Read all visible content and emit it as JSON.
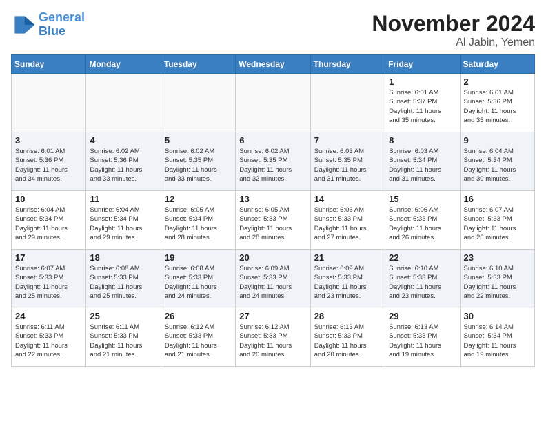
{
  "header": {
    "logo_line1": "General",
    "logo_line2": "Blue",
    "month": "November 2024",
    "location": "Al Jabin, Yemen"
  },
  "days_of_week": [
    "Sunday",
    "Monday",
    "Tuesday",
    "Wednesday",
    "Thursday",
    "Friday",
    "Saturday"
  ],
  "weeks": [
    [
      {
        "day": "",
        "info": "",
        "empty": true
      },
      {
        "day": "",
        "info": "",
        "empty": true
      },
      {
        "day": "",
        "info": "",
        "empty": true
      },
      {
        "day": "",
        "info": "",
        "empty": true
      },
      {
        "day": "",
        "info": "",
        "empty": true
      },
      {
        "day": "1",
        "info": "Sunrise: 6:01 AM\nSunset: 5:37 PM\nDaylight: 11 hours\nand 35 minutes."
      },
      {
        "day": "2",
        "info": "Sunrise: 6:01 AM\nSunset: 5:36 PM\nDaylight: 11 hours\nand 35 minutes."
      }
    ],
    [
      {
        "day": "3",
        "info": "Sunrise: 6:01 AM\nSunset: 5:36 PM\nDaylight: 11 hours\nand 34 minutes."
      },
      {
        "day": "4",
        "info": "Sunrise: 6:02 AM\nSunset: 5:36 PM\nDaylight: 11 hours\nand 33 minutes."
      },
      {
        "day": "5",
        "info": "Sunrise: 6:02 AM\nSunset: 5:35 PM\nDaylight: 11 hours\nand 33 minutes."
      },
      {
        "day": "6",
        "info": "Sunrise: 6:02 AM\nSunset: 5:35 PM\nDaylight: 11 hours\nand 32 minutes."
      },
      {
        "day": "7",
        "info": "Sunrise: 6:03 AM\nSunset: 5:35 PM\nDaylight: 11 hours\nand 31 minutes."
      },
      {
        "day": "8",
        "info": "Sunrise: 6:03 AM\nSunset: 5:34 PM\nDaylight: 11 hours\nand 31 minutes."
      },
      {
        "day": "9",
        "info": "Sunrise: 6:04 AM\nSunset: 5:34 PM\nDaylight: 11 hours\nand 30 minutes."
      }
    ],
    [
      {
        "day": "10",
        "info": "Sunrise: 6:04 AM\nSunset: 5:34 PM\nDaylight: 11 hours\nand 29 minutes."
      },
      {
        "day": "11",
        "info": "Sunrise: 6:04 AM\nSunset: 5:34 PM\nDaylight: 11 hours\nand 29 minutes."
      },
      {
        "day": "12",
        "info": "Sunrise: 6:05 AM\nSunset: 5:34 PM\nDaylight: 11 hours\nand 28 minutes."
      },
      {
        "day": "13",
        "info": "Sunrise: 6:05 AM\nSunset: 5:33 PM\nDaylight: 11 hours\nand 28 minutes."
      },
      {
        "day": "14",
        "info": "Sunrise: 6:06 AM\nSunset: 5:33 PM\nDaylight: 11 hours\nand 27 minutes."
      },
      {
        "day": "15",
        "info": "Sunrise: 6:06 AM\nSunset: 5:33 PM\nDaylight: 11 hours\nand 26 minutes."
      },
      {
        "day": "16",
        "info": "Sunrise: 6:07 AM\nSunset: 5:33 PM\nDaylight: 11 hours\nand 26 minutes."
      }
    ],
    [
      {
        "day": "17",
        "info": "Sunrise: 6:07 AM\nSunset: 5:33 PM\nDaylight: 11 hours\nand 25 minutes."
      },
      {
        "day": "18",
        "info": "Sunrise: 6:08 AM\nSunset: 5:33 PM\nDaylight: 11 hours\nand 25 minutes."
      },
      {
        "day": "19",
        "info": "Sunrise: 6:08 AM\nSunset: 5:33 PM\nDaylight: 11 hours\nand 24 minutes."
      },
      {
        "day": "20",
        "info": "Sunrise: 6:09 AM\nSunset: 5:33 PM\nDaylight: 11 hours\nand 24 minutes."
      },
      {
        "day": "21",
        "info": "Sunrise: 6:09 AM\nSunset: 5:33 PM\nDaylight: 11 hours\nand 23 minutes."
      },
      {
        "day": "22",
        "info": "Sunrise: 6:10 AM\nSunset: 5:33 PM\nDaylight: 11 hours\nand 23 minutes."
      },
      {
        "day": "23",
        "info": "Sunrise: 6:10 AM\nSunset: 5:33 PM\nDaylight: 11 hours\nand 22 minutes."
      }
    ],
    [
      {
        "day": "24",
        "info": "Sunrise: 6:11 AM\nSunset: 5:33 PM\nDaylight: 11 hours\nand 22 minutes."
      },
      {
        "day": "25",
        "info": "Sunrise: 6:11 AM\nSunset: 5:33 PM\nDaylight: 11 hours\nand 21 minutes."
      },
      {
        "day": "26",
        "info": "Sunrise: 6:12 AM\nSunset: 5:33 PM\nDaylight: 11 hours\nand 21 minutes."
      },
      {
        "day": "27",
        "info": "Sunrise: 6:12 AM\nSunset: 5:33 PM\nDaylight: 11 hours\nand 20 minutes."
      },
      {
        "day": "28",
        "info": "Sunrise: 6:13 AM\nSunset: 5:33 PM\nDaylight: 11 hours\nand 20 minutes."
      },
      {
        "day": "29",
        "info": "Sunrise: 6:13 AM\nSunset: 5:33 PM\nDaylight: 11 hours\nand 19 minutes."
      },
      {
        "day": "30",
        "info": "Sunrise: 6:14 AM\nSunset: 5:34 PM\nDaylight: 11 hours\nand 19 minutes."
      }
    ]
  ]
}
